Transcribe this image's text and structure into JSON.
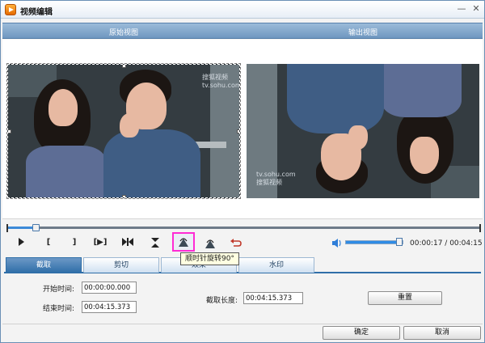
{
  "window": {
    "title": "视频编辑"
  },
  "title_buttons": {
    "minimize": "—",
    "close": "✕"
  },
  "views": {
    "left": "原始视图",
    "right": "输出视图"
  },
  "preview": {
    "watermark_top": "搜狐视频\ntv.sohu.com",
    "watermark_bottom": "tv.sohu.com\n搜狐视频"
  },
  "timeline": {
    "progress": 0.06
  },
  "toolbar": {
    "buttons": [
      {
        "name": "play",
        "glyph": "▶"
      },
      {
        "name": "mark-in",
        "glyph": "["
      },
      {
        "name": "mark-out",
        "glyph": "]"
      },
      {
        "name": "play-selection",
        "glyph": "[▶]"
      },
      {
        "name": "jump-ends",
        "glyph": "▶◀"
      },
      {
        "name": "flip-vertical",
        "glyph": "⧗"
      },
      {
        "name": "rotate-ccw",
        "glyph": ""
      },
      {
        "name": "rotate-cw",
        "glyph": ""
      },
      {
        "name": "undo",
        "glyph": ""
      }
    ],
    "tooltip": "顺时针旋转90°"
  },
  "volume": {
    "level": 0.95
  },
  "time": {
    "current": "00:00:17",
    "total": "00:04:15",
    "separator": " / "
  },
  "tabs": [
    "截取",
    "剪切",
    "效果",
    "水印"
  ],
  "form": {
    "start_label": "开始时间:",
    "start_value": "00:00:00.000",
    "end_label": "结束时间:",
    "end_value": "00:04:15.373",
    "length_label": "截取长度:",
    "length_value": "00:04:15.373",
    "reset_label": "重置"
  },
  "footer": {
    "ok_label": "确定",
    "cancel_label": "取消"
  }
}
